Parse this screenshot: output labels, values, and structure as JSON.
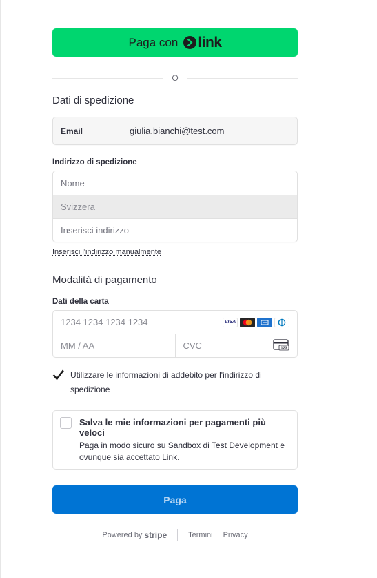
{
  "link_button": {
    "prefix": "Paga con",
    "brand": "link"
  },
  "divider": {
    "text": "O"
  },
  "shipping": {
    "title": "Dati di spedizione",
    "email_label": "Email",
    "email_value": "giulia.bianchi@test.com",
    "address_label": "Indirizzo di spedizione",
    "name_placeholder": "Nome",
    "country": "Svizzera",
    "address_placeholder": "Inserisci indirizzo",
    "manual_link": "Inserisci l'indirizzo manualmente"
  },
  "payment": {
    "title": "Modalità di pagamento",
    "card_label": "Dati della carta",
    "card_number_placeholder": "1234 1234 1234 1234",
    "expiry_placeholder": "MM / AA",
    "cvc_placeholder": "CVC",
    "brands": [
      "visa-icon",
      "mastercard-icon",
      "amex-icon",
      "diners-icon"
    ],
    "brand_labels": {
      "visa": "VISA",
      "cvc_icon": "123"
    }
  },
  "billing_checkbox": {
    "checked": true,
    "text": "Utilizzare le informazioni di addebito per l'indirizzo di spedizione"
  },
  "save_info": {
    "checked": false,
    "title": "Salva le mie informazioni per pagamenti più veloci",
    "desc_before": "Paga in modo sicuro su Sandbox di Test Development e ovunque sia accettato ",
    "desc_link": "Link",
    "desc_after": "."
  },
  "pay_button": {
    "label": "Paga"
  },
  "footer": {
    "powered_by": "Powered by",
    "stripe": "stripe",
    "terms": "Termini",
    "privacy": "Privacy"
  },
  "colors": {
    "link_green": "#00d66f",
    "pay_blue": "#0074d4",
    "text": "#30313d"
  }
}
